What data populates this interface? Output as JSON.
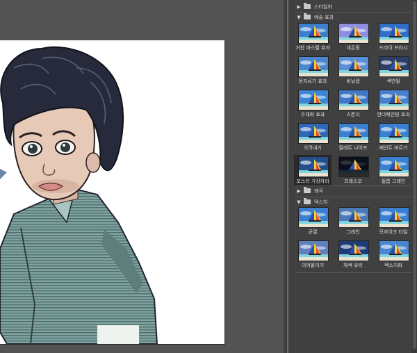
{
  "panel": {
    "groups": [
      {
        "label": "스타일화",
        "expanded": false,
        "icon": "folder-icon"
      },
      {
        "label": "예술 효과",
        "expanded": true,
        "icon": "folder-open-icon"
      },
      {
        "label": "왜곡",
        "expanded": false,
        "icon": "folder-icon"
      },
      {
        "label": "텍스처",
        "expanded": true,
        "icon": "folder-open-icon"
      }
    ],
    "artistic_items": [
      "거친 파스텔 효과",
      "네온광",
      "드라이 브러시",
      "문지르기 효과",
      "비닐랩",
      "색연필",
      "수채화 효과",
      "스폰지",
      "언더페인팅 효과",
      "오려내기",
      "팔레트 나이프",
      "페인트 바르기",
      "포스터 가장자리",
      "프레스코",
      "필름 그레인"
    ],
    "texture_items": [
      "균열",
      "그레인",
      "모자이크 타일",
      "이어붙이기",
      "채색 유리",
      "텍스처화"
    ],
    "selected_item": "포스터 가장자리"
  },
  "colors": {
    "workspace": "#535353",
    "panel": "#404040",
    "selected": "#2a2a2a",
    "text": "#e0e0e0"
  }
}
